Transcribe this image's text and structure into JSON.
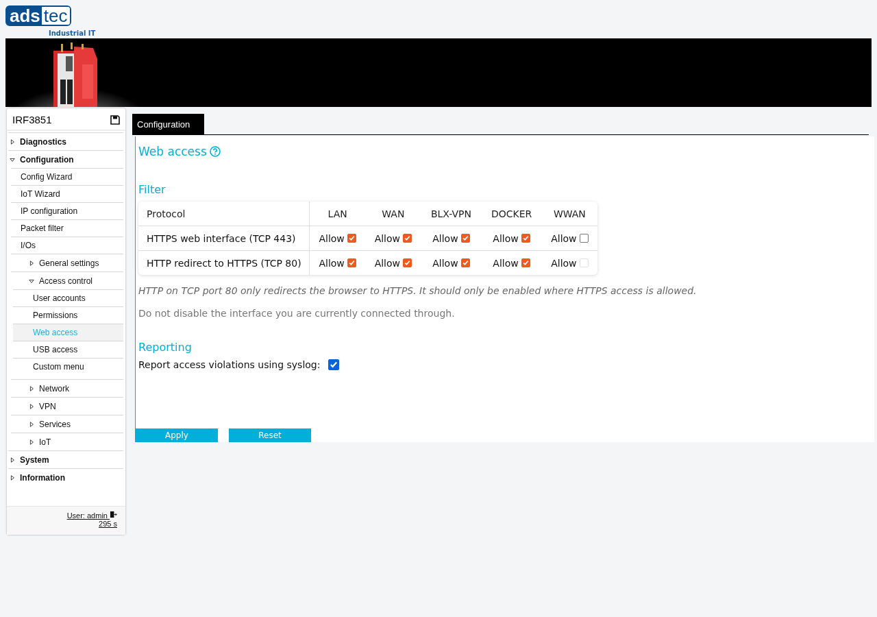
{
  "logo": {
    "left": "ads",
    "right": "tec",
    "tagline": "Industrial IT"
  },
  "sidebar": {
    "device": "IRF3851",
    "items": [
      {
        "kind": "folder",
        "label": "Diagnostics",
        "expanded": false
      },
      {
        "kind": "folder",
        "label": "Configuration",
        "expanded": true,
        "children": [
          {
            "kind": "page",
            "label": "Config Wizard",
            "selected": false
          },
          {
            "kind": "page",
            "label": "IoT Wizard",
            "selected": false
          },
          {
            "kind": "page",
            "label": "IP configuration",
            "selected": false
          },
          {
            "kind": "page",
            "label": "Packet filter",
            "selected": false
          },
          {
            "kind": "page",
            "label": "I/Os",
            "selected": false
          },
          {
            "kind": "folder",
            "label": "General settings",
            "expanded": false
          },
          {
            "kind": "folder",
            "label": "Access control",
            "expanded": true,
            "children": [
              {
                "kind": "page",
                "label": "User accounts",
                "selected": false
              },
              {
                "kind": "page",
                "label": "Permissions",
                "selected": false
              },
              {
                "kind": "page",
                "label": "Web access",
                "selected": true
              },
              {
                "kind": "page",
                "label": "USB access",
                "selected": false
              },
              {
                "kind": "page",
                "label": "Custom menu",
                "selected": false
              }
            ]
          },
          {
            "kind": "folder",
            "label": "Network",
            "expanded": false
          },
          {
            "kind": "folder",
            "label": "VPN",
            "expanded": false
          },
          {
            "kind": "folder",
            "label": "Services",
            "expanded": false
          },
          {
            "kind": "folder",
            "label": "IoT",
            "expanded": false
          }
        ]
      },
      {
        "kind": "folder",
        "label": "System",
        "expanded": false
      },
      {
        "kind": "folder",
        "label": "Information",
        "expanded": false
      }
    ],
    "user": "User: admin",
    "timer": "295 s"
  },
  "tabs": [
    {
      "label": "Configuration",
      "selected": true
    }
  ],
  "page": {
    "title": "Web access",
    "filter": {
      "heading": "Filter",
      "columns": [
        "Protocol",
        "LAN",
        "WAN",
        "BLX-VPN",
        "DOCKER",
        "WWAN"
      ],
      "rows": [
        {
          "cells": [
            {
              "kind": "text",
              "text": "HTTPS web interface (TCP 443)"
            },
            {
              "label": "Allow",
              "checked": true,
              "disabled": false
            },
            {
              "label": "Allow",
              "checked": true,
              "disabled": false
            },
            {
              "label": "Allow",
              "checked": true,
              "disabled": false
            },
            {
              "label": "Allow",
              "checked": true,
              "disabled": false
            },
            {
              "label": "Allow",
              "checked": false,
              "disabled": false
            }
          ]
        },
        {
          "cells": [
            {
              "kind": "text",
              "text": "HTTP redirect to HTTPS (TCP 80)"
            },
            {
              "label": "Allow",
              "checked": true,
              "disabled": false
            },
            {
              "label": "Allow",
              "checked": true,
              "disabled": false
            },
            {
              "label": "Allow",
              "checked": true,
              "disabled": false
            },
            {
              "label": "Allow",
              "checked": true,
              "disabled": false
            },
            {
              "label": "Allow",
              "checked": false,
              "disabled": true
            }
          ]
        }
      ]
    },
    "note": "HTTP on TCP port 80 only redirects the browser to HTTPS. It should only be enabled where HTTPS access is allowed.",
    "hint": "Do not disable the interface you are currently connected through.",
    "reporting": {
      "heading": "Reporting",
      "label": "Report access violations using syslog:",
      "checked": true
    },
    "buttons": [
      "Apply",
      "Reset"
    ]
  }
}
